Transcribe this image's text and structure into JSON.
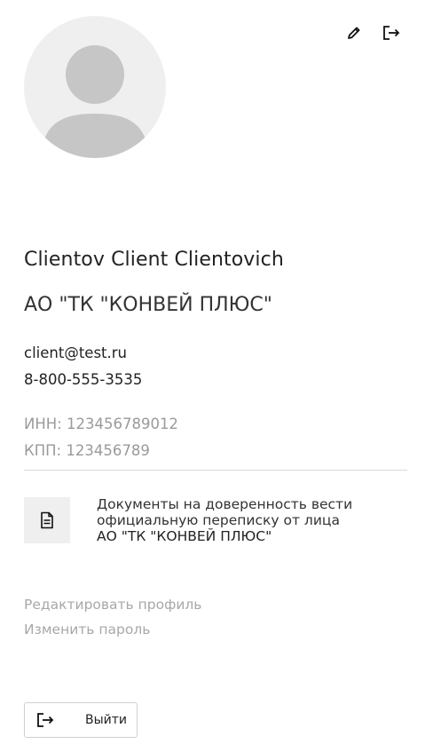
{
  "header": {
    "edit_icon": "pencil-icon",
    "logout_icon": "logout-icon"
  },
  "profile": {
    "avatar_icon": "avatar-placeholder",
    "full_name": "Clientov Client Clientovich",
    "company": "АО \"ТК \"КОНВЕЙ ПЛЮС\"",
    "email": "client@test.ru",
    "phone": "8-800-555-3535",
    "inn": "ИНН: 123456789012",
    "kpp": "КПП: 123456789"
  },
  "document": {
    "icon": "document-icon",
    "line1": "Документы на доверенность вести",
    "line2": "официальную переписку от лица",
    "company": "АО \"ТК \"КОНВЕЙ ПЛЮС\""
  },
  "links": {
    "edit_profile": "Редактировать профиль",
    "change_password": "Изменить пароль"
  },
  "logout_button": {
    "icon": "logout-icon",
    "label": "Выйти"
  }
}
